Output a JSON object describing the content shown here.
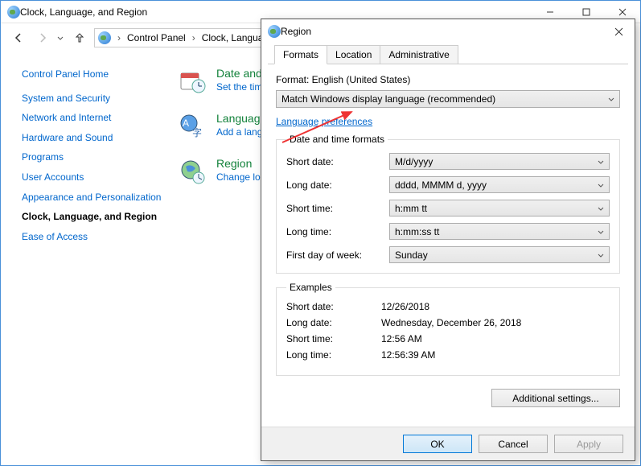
{
  "window": {
    "title": "Clock, Language, and Region"
  },
  "breadcrumb": {
    "root": "Control Panel",
    "leaf": "Clock, Language, and Region"
  },
  "sidebar": {
    "home": "Control Panel Home",
    "items": [
      "System and Security",
      "Network and Internet",
      "Hardware and Sound",
      "Programs",
      "User Accounts",
      "Appearance and Personalization",
      "Clock, Language, and Region",
      "Ease of Access"
    ]
  },
  "categories": [
    {
      "title": "Date and Time",
      "sub": "Set the time and date"
    },
    {
      "title": "Language",
      "sub": "Add a language"
    },
    {
      "title": "Region",
      "sub": "Change location"
    }
  ],
  "dialog": {
    "title": "Region",
    "tabs": [
      "Formats",
      "Location",
      "Administrative"
    ],
    "format_label": "Format: English (United States)",
    "format_dropdown": "Match Windows display language (recommended)",
    "lang_pref": "Language preferences",
    "dt_legend": "Date and time formats",
    "rows": {
      "short_date_lbl": "Short date:",
      "short_date_val": "M/d/yyyy",
      "long_date_lbl": "Long date:",
      "long_date_val": "dddd, MMMM d, yyyy",
      "short_time_lbl": "Short time:",
      "short_time_val": "h:mm tt",
      "long_time_lbl": "Long time:",
      "long_time_val": "h:mm:ss tt",
      "first_day_lbl": "First day of week:",
      "first_day_val": "Sunday"
    },
    "ex_legend": "Examples",
    "examples": {
      "short_date_lbl": "Short date:",
      "short_date_val": "12/26/2018",
      "long_date_lbl": "Long date:",
      "long_date_val": "Wednesday, December 26, 2018",
      "short_time_lbl": "Short time:",
      "short_time_val": "12:56 AM",
      "long_time_lbl": "Long time:",
      "long_time_val": "12:56:39 AM"
    },
    "additional": "Additional settings...",
    "ok": "OK",
    "cancel": "Cancel",
    "apply": "Apply"
  }
}
